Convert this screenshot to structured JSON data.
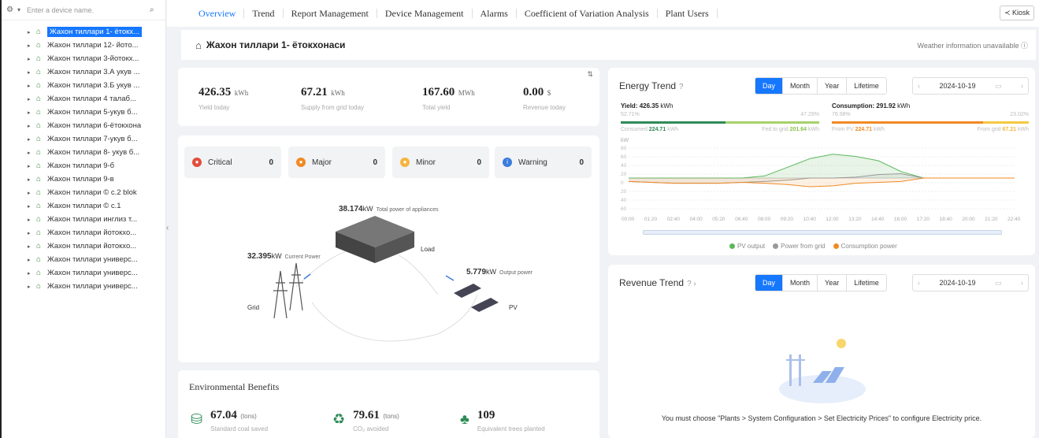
{
  "sidebar": {
    "search_placeholder": "Enter a device name.",
    "items": [
      {
        "label": "Жахон тиллари 1- ётокх..."
      },
      {
        "label": "Жахон тиллари 12- йото..."
      },
      {
        "label": "Жахон тиллари 3-йотокх..."
      },
      {
        "label": "Жахон тиллари 3.А укув ..."
      },
      {
        "label": "Жахон тиллари 3.Б укув ..."
      },
      {
        "label": "Жахон тиллари 4 талаб..."
      },
      {
        "label": "Жахон тиллари 5-укув б..."
      },
      {
        "label": "Жахон тиллари 6-ётокхона"
      },
      {
        "label": "Жахон тиллари 7-укув б..."
      },
      {
        "label": "Жахон тиллари 8- укув б..."
      },
      {
        "label": "Жахон тиллари 9-б"
      },
      {
        "label": "Жахон тиллари 9-в"
      },
      {
        "label": "Жахон тиллари © с.2 blok"
      },
      {
        "label": "Жахон тиллари © с.1"
      },
      {
        "label": "Жахон тиллари инглиз т..."
      },
      {
        "label": "Жахон тиллари йотокхо..."
      },
      {
        "label": "Жахон тиллари йотокхо..."
      },
      {
        "label": "Жахон тиллари универс..."
      },
      {
        "label": "Жахон тиллари универс..."
      },
      {
        "label": "Жахон тиллари универс..."
      }
    ]
  },
  "nav": {
    "tabs": [
      "Overview",
      "Trend",
      "Report Management",
      "Device Management",
      "Alarms",
      "Coefficient of Variation Analysis",
      "Plant Users"
    ],
    "kiosk": "Kiosk"
  },
  "plant": {
    "title": "Жахон тиллари 1- ётокхонаси",
    "weather": "Weather information unavailable"
  },
  "kpis": [
    {
      "value": "426.35",
      "unit": "kWh",
      "label": "Yield today"
    },
    {
      "value": "67.21",
      "unit": "kWh",
      "label": "Supply from grid today"
    },
    {
      "value": "167.60",
      "unit": "MWh",
      "label": "Total yield"
    },
    {
      "value": "0.00",
      "unit": "$",
      "label": "Revenue today"
    }
  ],
  "alarms": [
    {
      "label": "Critical",
      "count": "0",
      "color": "#e34d3c"
    },
    {
      "label": "Major",
      "count": "0",
      "color": "#f08a24"
    },
    {
      "label": "Minor",
      "count": "0",
      "color": "#f5b53d"
    },
    {
      "label": "Warning",
      "count": "0",
      "color": "#3b7ddd"
    }
  ],
  "flow": {
    "total_value": "38.174",
    "total_unit": "kW",
    "total_label": "Total power of appliances",
    "current_value": "32.395",
    "current_unit": "kW",
    "current_label": "Current Power",
    "output_value": "5.779",
    "output_unit": "kW",
    "output_label": "Output power",
    "load": "Load",
    "grid": "Grid",
    "pv": "PV"
  },
  "env": {
    "title": "Environmental Benefits",
    "items": [
      {
        "value": "67.04",
        "unit": "(tons)",
        "label": "Standard coal saved"
      },
      {
        "value": "79.61",
        "unit": "(tons)",
        "label": "CO₂ avoided"
      },
      {
        "value": "109",
        "unit": "",
        "label": "Equivalent trees planted"
      }
    ]
  },
  "energy": {
    "title": "Energy Trend",
    "periods": [
      "Day",
      "Month",
      "Year",
      "Lifetime"
    ],
    "date": "2024-10-19",
    "yield_label": "Yield: 426.35",
    "yield_unit": "kWh",
    "consumption_label": "Consumption: 291.92",
    "consumption_unit": "kWh",
    "pct_consumed": "52.71%",
    "pct_feed": "47.29%",
    "pct_pv": "76.98%",
    "pct_grid": "23.02%",
    "consumed_label": "Consumed",
    "consumed_value": "224.71",
    "consumed_unit": "kWh",
    "feed_label": "Fed to grid",
    "feed_value": "201.64",
    "feed_unit": "kWh",
    "frompv_label": "From PV",
    "frompv_value": "224.71",
    "frompv_unit": "kWh",
    "fromgrid_label": "From grid",
    "fromgrid_value": "67.21",
    "fromgrid_unit": "kWh",
    "y_unit": "kW",
    "legend": [
      "PV output",
      "Power from grid",
      "Consumption power"
    ],
    "colors": {
      "pv": "#5cb85c",
      "grid": "#999999",
      "cons": "#f08a24"
    }
  },
  "chart_data": {
    "type": "line",
    "x": [
      "00:00",
      "01:20",
      "02:40",
      "04:00",
      "05:20",
      "06:40",
      "08:00",
      "09:20",
      "10:40",
      "12:00",
      "13:20",
      "14:40",
      "16:00",
      "17:20",
      "18:40",
      "20:00",
      "21:20",
      "22:40"
    ],
    "yticks": [
      "80",
      "60",
      "40",
      "20",
      "0",
      "20",
      "40",
      "60"
    ],
    "ylabel": "kW",
    "series": [
      {
        "name": "PV output",
        "values": [
          0,
          0,
          0,
          0,
          0,
          0,
          5,
          25,
          45,
          55,
          50,
          40,
          15,
          0,
          0,
          0,
          0,
          0
        ]
      },
      {
        "name": "Power from grid",
        "values": [
          -8,
          -10,
          -12,
          -12,
          -12,
          -10,
          -8,
          -5,
          0,
          0,
          2,
          8,
          10,
          0,
          0,
          0,
          0,
          0
        ]
      },
      {
        "name": "Consumption power",
        "values": [
          -8,
          -10,
          -12,
          -12,
          -12,
          -10,
          -12,
          -15,
          -20,
          -18,
          -12,
          -10,
          -8,
          0,
          0,
          0,
          0,
          0
        ]
      }
    ]
  },
  "revenue": {
    "title": "Revenue Trend",
    "periods": [
      "Day",
      "Month",
      "Year",
      "Lifetime"
    ],
    "date": "2024-10-19",
    "message": "You must choose \"Plants > System Configuration > Set Electricity Prices\" to configure Electricity price."
  }
}
